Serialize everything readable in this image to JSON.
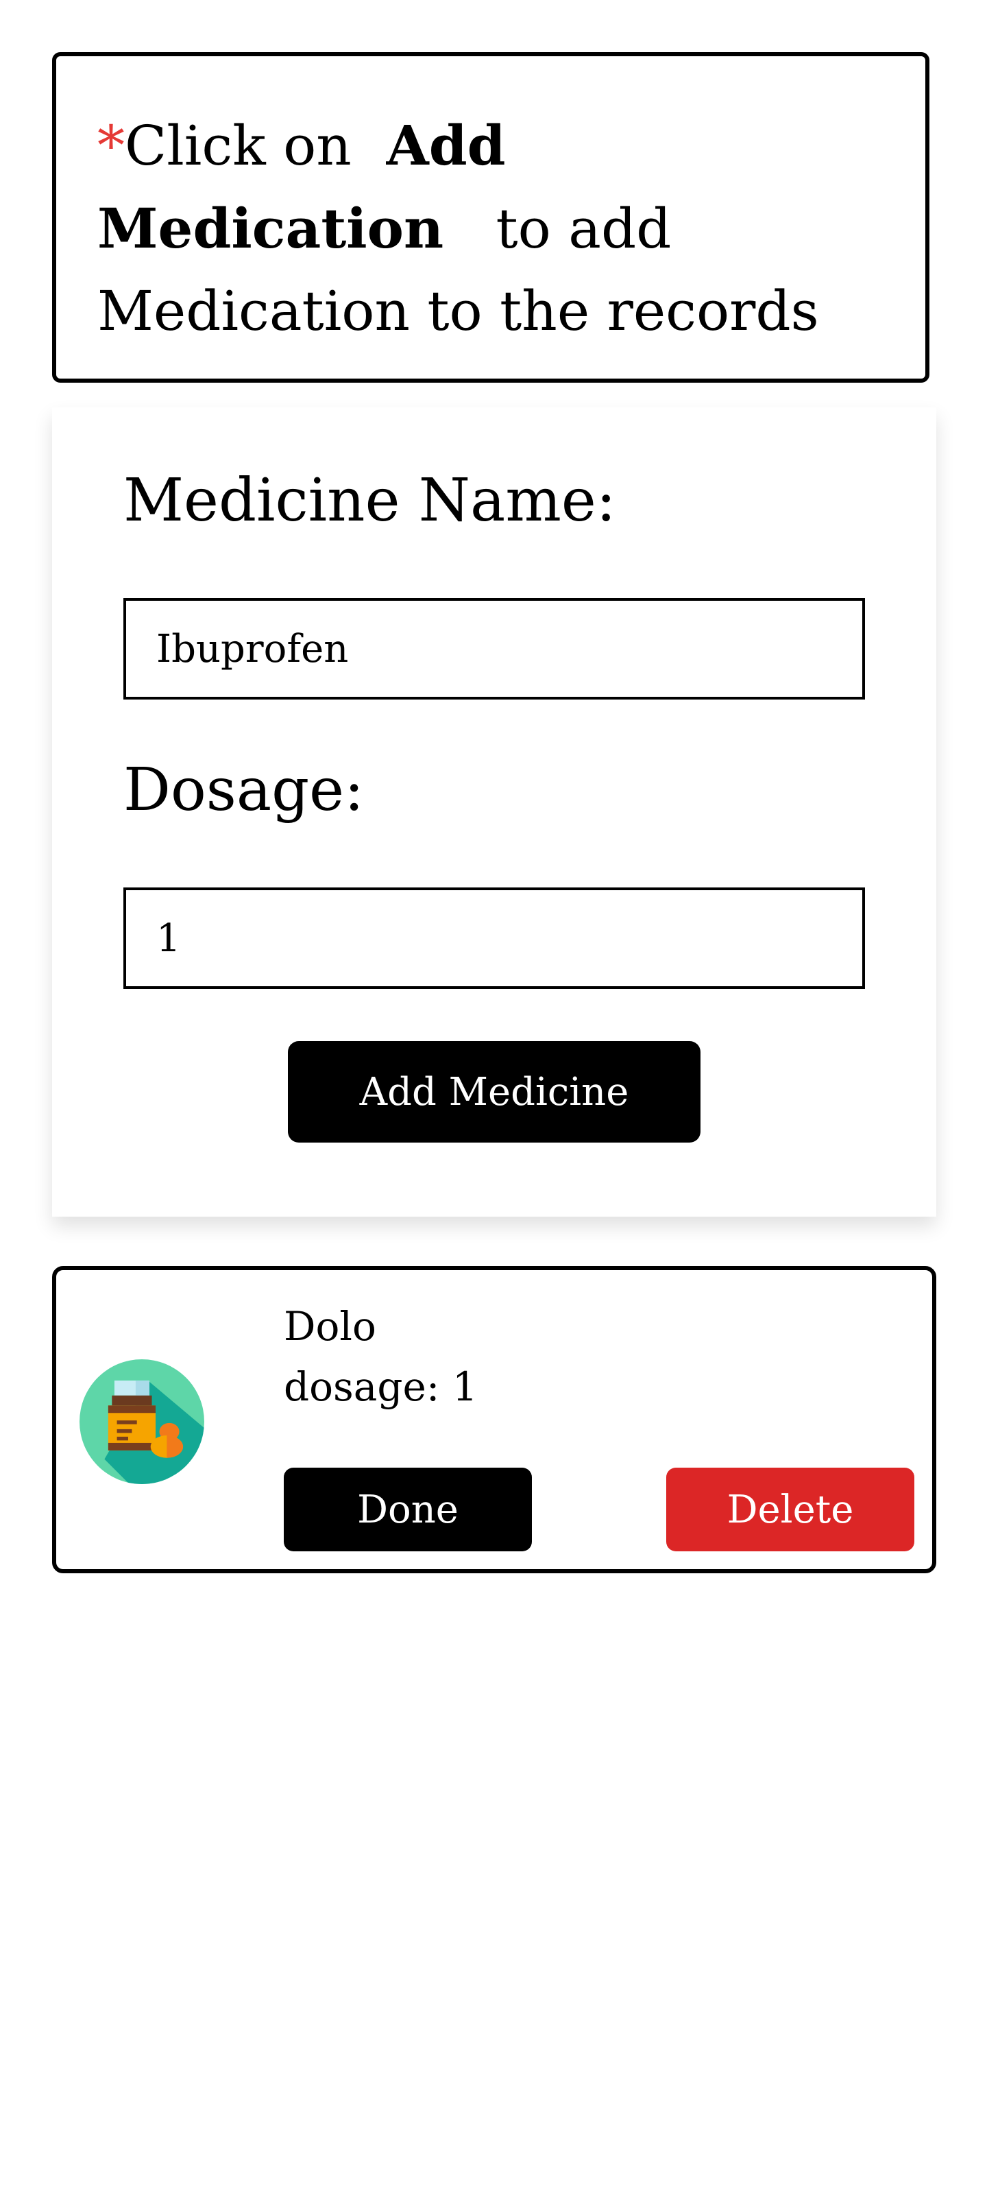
{
  "notice": {
    "star": "*",
    "text_before": "Click on",
    "bold": "Add Medication",
    "text_after": "to add Medication to the records"
  },
  "form": {
    "name_label": "Medicine Name:",
    "name_value": "Ibuprofen",
    "dosage_label": "Dosage:",
    "dosage_value": "1",
    "submit_label": "Add Medicine"
  },
  "medications": [
    {
      "name": "Dolo",
      "dosage_text": "dosage: 1",
      "icon": "medicine-bottle-icon",
      "done_label": "Done",
      "delete_label": "Delete"
    }
  ],
  "colors": {
    "accent_red": "#dc2626",
    "star_red": "#e53935",
    "button_black": "#000000",
    "icon_teal": "#14b8a6",
    "icon_green": "#5ed6a8"
  }
}
